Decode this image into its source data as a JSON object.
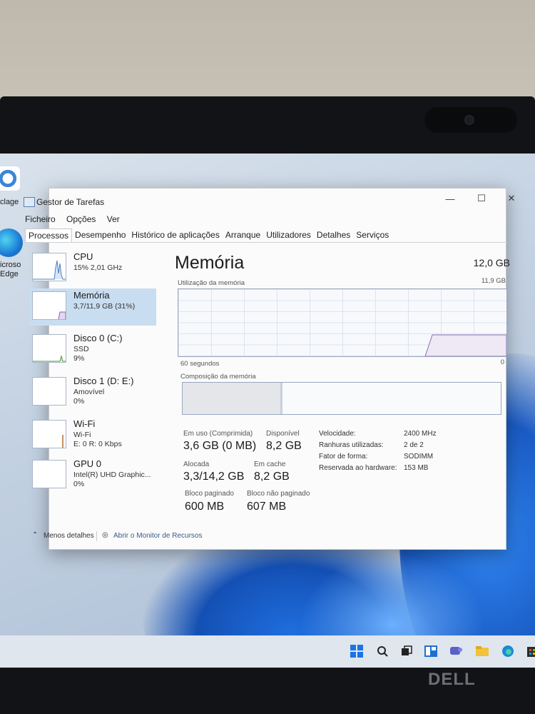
{
  "desktop": {
    "icons": [
      {
        "label": "clage",
        "icon": "recycle-bin-icon"
      },
      {
        "label": "icroso\nEdge",
        "icon": "edge-icon"
      }
    ],
    "taskbar_icons": [
      "windows-start-icon",
      "search-icon",
      "task-view-icon",
      "widgets-icon",
      "chat-icon",
      "file-explorer-icon",
      "edge-icon",
      "store-icon"
    ],
    "brand": "DELL"
  },
  "window": {
    "title": "Gestor de Tarefas",
    "controls": {
      "minimize": "—",
      "maximize": "☐",
      "close": "✕"
    },
    "menu": [
      "Ficheiro",
      "Opções",
      "Ver"
    ],
    "tabs": [
      "Processos",
      "Desempenho",
      "Histórico de aplicações",
      "Arranque",
      "Utilizadores",
      "Detalhes",
      "Serviços"
    ],
    "active_tab": "Processos"
  },
  "sidebar": {
    "items": [
      {
        "name": "CPU",
        "lines": [
          "15% 2,01 GHz"
        ]
      },
      {
        "name": "Memória",
        "lines": [
          "3,7/11,9 GB (31%)"
        ]
      },
      {
        "name": "Disco 0 (C:)",
        "lines": [
          "SSD",
          "9%"
        ]
      },
      {
        "name": "Disco 1 (D: E:)",
        "lines": [
          "Amovível",
          "0%"
        ]
      },
      {
        "name": "Wi-Fi",
        "lines": [
          "Wi-Fi",
          "E: 0 R: 0 Kbps"
        ]
      },
      {
        "name": "GPU 0",
        "lines": [
          "Intel(R) UHD Graphic...",
          "0%"
        ]
      }
    ],
    "selected": "Memória"
  },
  "memory": {
    "title": "Memória",
    "total": "12,0 GB",
    "graph_label": "Utilização da memória",
    "graph_max": "11,9 GB",
    "time_label": "60 segundos",
    "time_end": "0",
    "composition_label": "Composição da memória",
    "usage_fraction": 0.31,
    "stats": {
      "in_use_label": "Em uso (Comprimida)",
      "in_use_value": "3,6 GB (0 MB)",
      "available_label": "Disponível",
      "available_value": "8,2 GB",
      "committed_label": "Alocada",
      "committed_value": "3,3/14,2 GB",
      "cached_label": "Em cache",
      "cached_value": "8,2 GB",
      "paged_label": "Bloco paginado",
      "paged_value": "600 MB",
      "nonpaged_label": "Bloco não paginado",
      "nonpaged_value": "607 MB"
    },
    "details": [
      {
        "key": "Velocidade:",
        "value": "2400 MHz"
      },
      {
        "key": "Ranhuras utilizadas:",
        "value": "2 de 2"
      },
      {
        "key": "Fator de forma:",
        "value": "SODIMM"
      },
      {
        "key": "Reservada ao hardware:",
        "value": "153 MB"
      }
    ]
  },
  "footer": {
    "fewer_details": "Menos detalhes",
    "resource_monitor": "Abrir o Monitor de Recursos"
  }
}
